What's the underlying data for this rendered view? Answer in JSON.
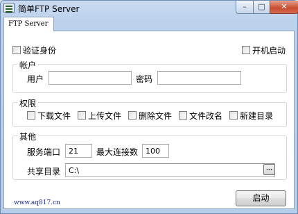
{
  "window": {
    "title": "简单FTP Server",
    "minimize_glyph": "–",
    "maximize_glyph": "□",
    "close_glyph": "✕"
  },
  "tab": {
    "label": "FTP Server"
  },
  "options": {
    "auth_label": "验证身份",
    "auth_checked": false,
    "autostart_label": "开机启动",
    "autostart_checked": false
  },
  "account": {
    "title": "帐户",
    "user_label": "用户",
    "user_value": "",
    "password_label": "密码",
    "password_value": ""
  },
  "permissions": {
    "title": "权限",
    "items": [
      {
        "label": "下载文件",
        "checked": false
      },
      {
        "label": "上传文件",
        "checked": false
      },
      {
        "label": "删除文件",
        "checked": false
      },
      {
        "label": "文件改名",
        "checked": false
      },
      {
        "label": "新建目录",
        "checked": false
      }
    ]
  },
  "other": {
    "title": "其他",
    "port_label": "服务端口",
    "port_value": "21",
    "maxconn_label": "最大连接数",
    "maxconn_value": "100",
    "share_label": "共享目录",
    "share_value": "C:\\",
    "browse_label": "..."
  },
  "footer": {
    "link_text": "www.aq817.cn",
    "start_button": "启动"
  }
}
